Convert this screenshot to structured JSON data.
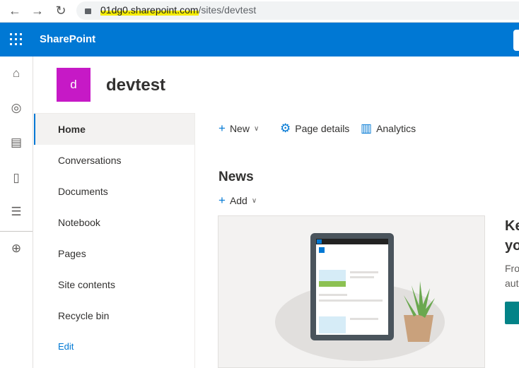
{
  "browser": {
    "url_host": "01dg0.sharepoint.com",
    "url_path": "/sites/devtest"
  },
  "suite": {
    "brand": "SharePoint"
  },
  "site": {
    "logo_letter": "d",
    "title": "devtest"
  },
  "nav": {
    "items": [
      {
        "label": "Home",
        "selected": true
      },
      {
        "label": "Conversations"
      },
      {
        "label": "Documents"
      },
      {
        "label": "Notebook"
      },
      {
        "label": "Pages"
      },
      {
        "label": "Site contents"
      },
      {
        "label": "Recycle bin"
      }
    ],
    "edit": "Edit"
  },
  "commands": {
    "new": "New",
    "page_details": "Page details",
    "analytics": "Analytics"
  },
  "news": {
    "heading": "News",
    "add": "Add",
    "promo_heading_1": "Ke",
    "promo_heading_2": "yo",
    "promo_text_1": "Fro",
    "promo_text_2": "aut"
  },
  "colors": {
    "suite_bar": "#0078d4",
    "logo": "#c619c6",
    "accent": "#0078d4",
    "promo_button": "#038387"
  }
}
